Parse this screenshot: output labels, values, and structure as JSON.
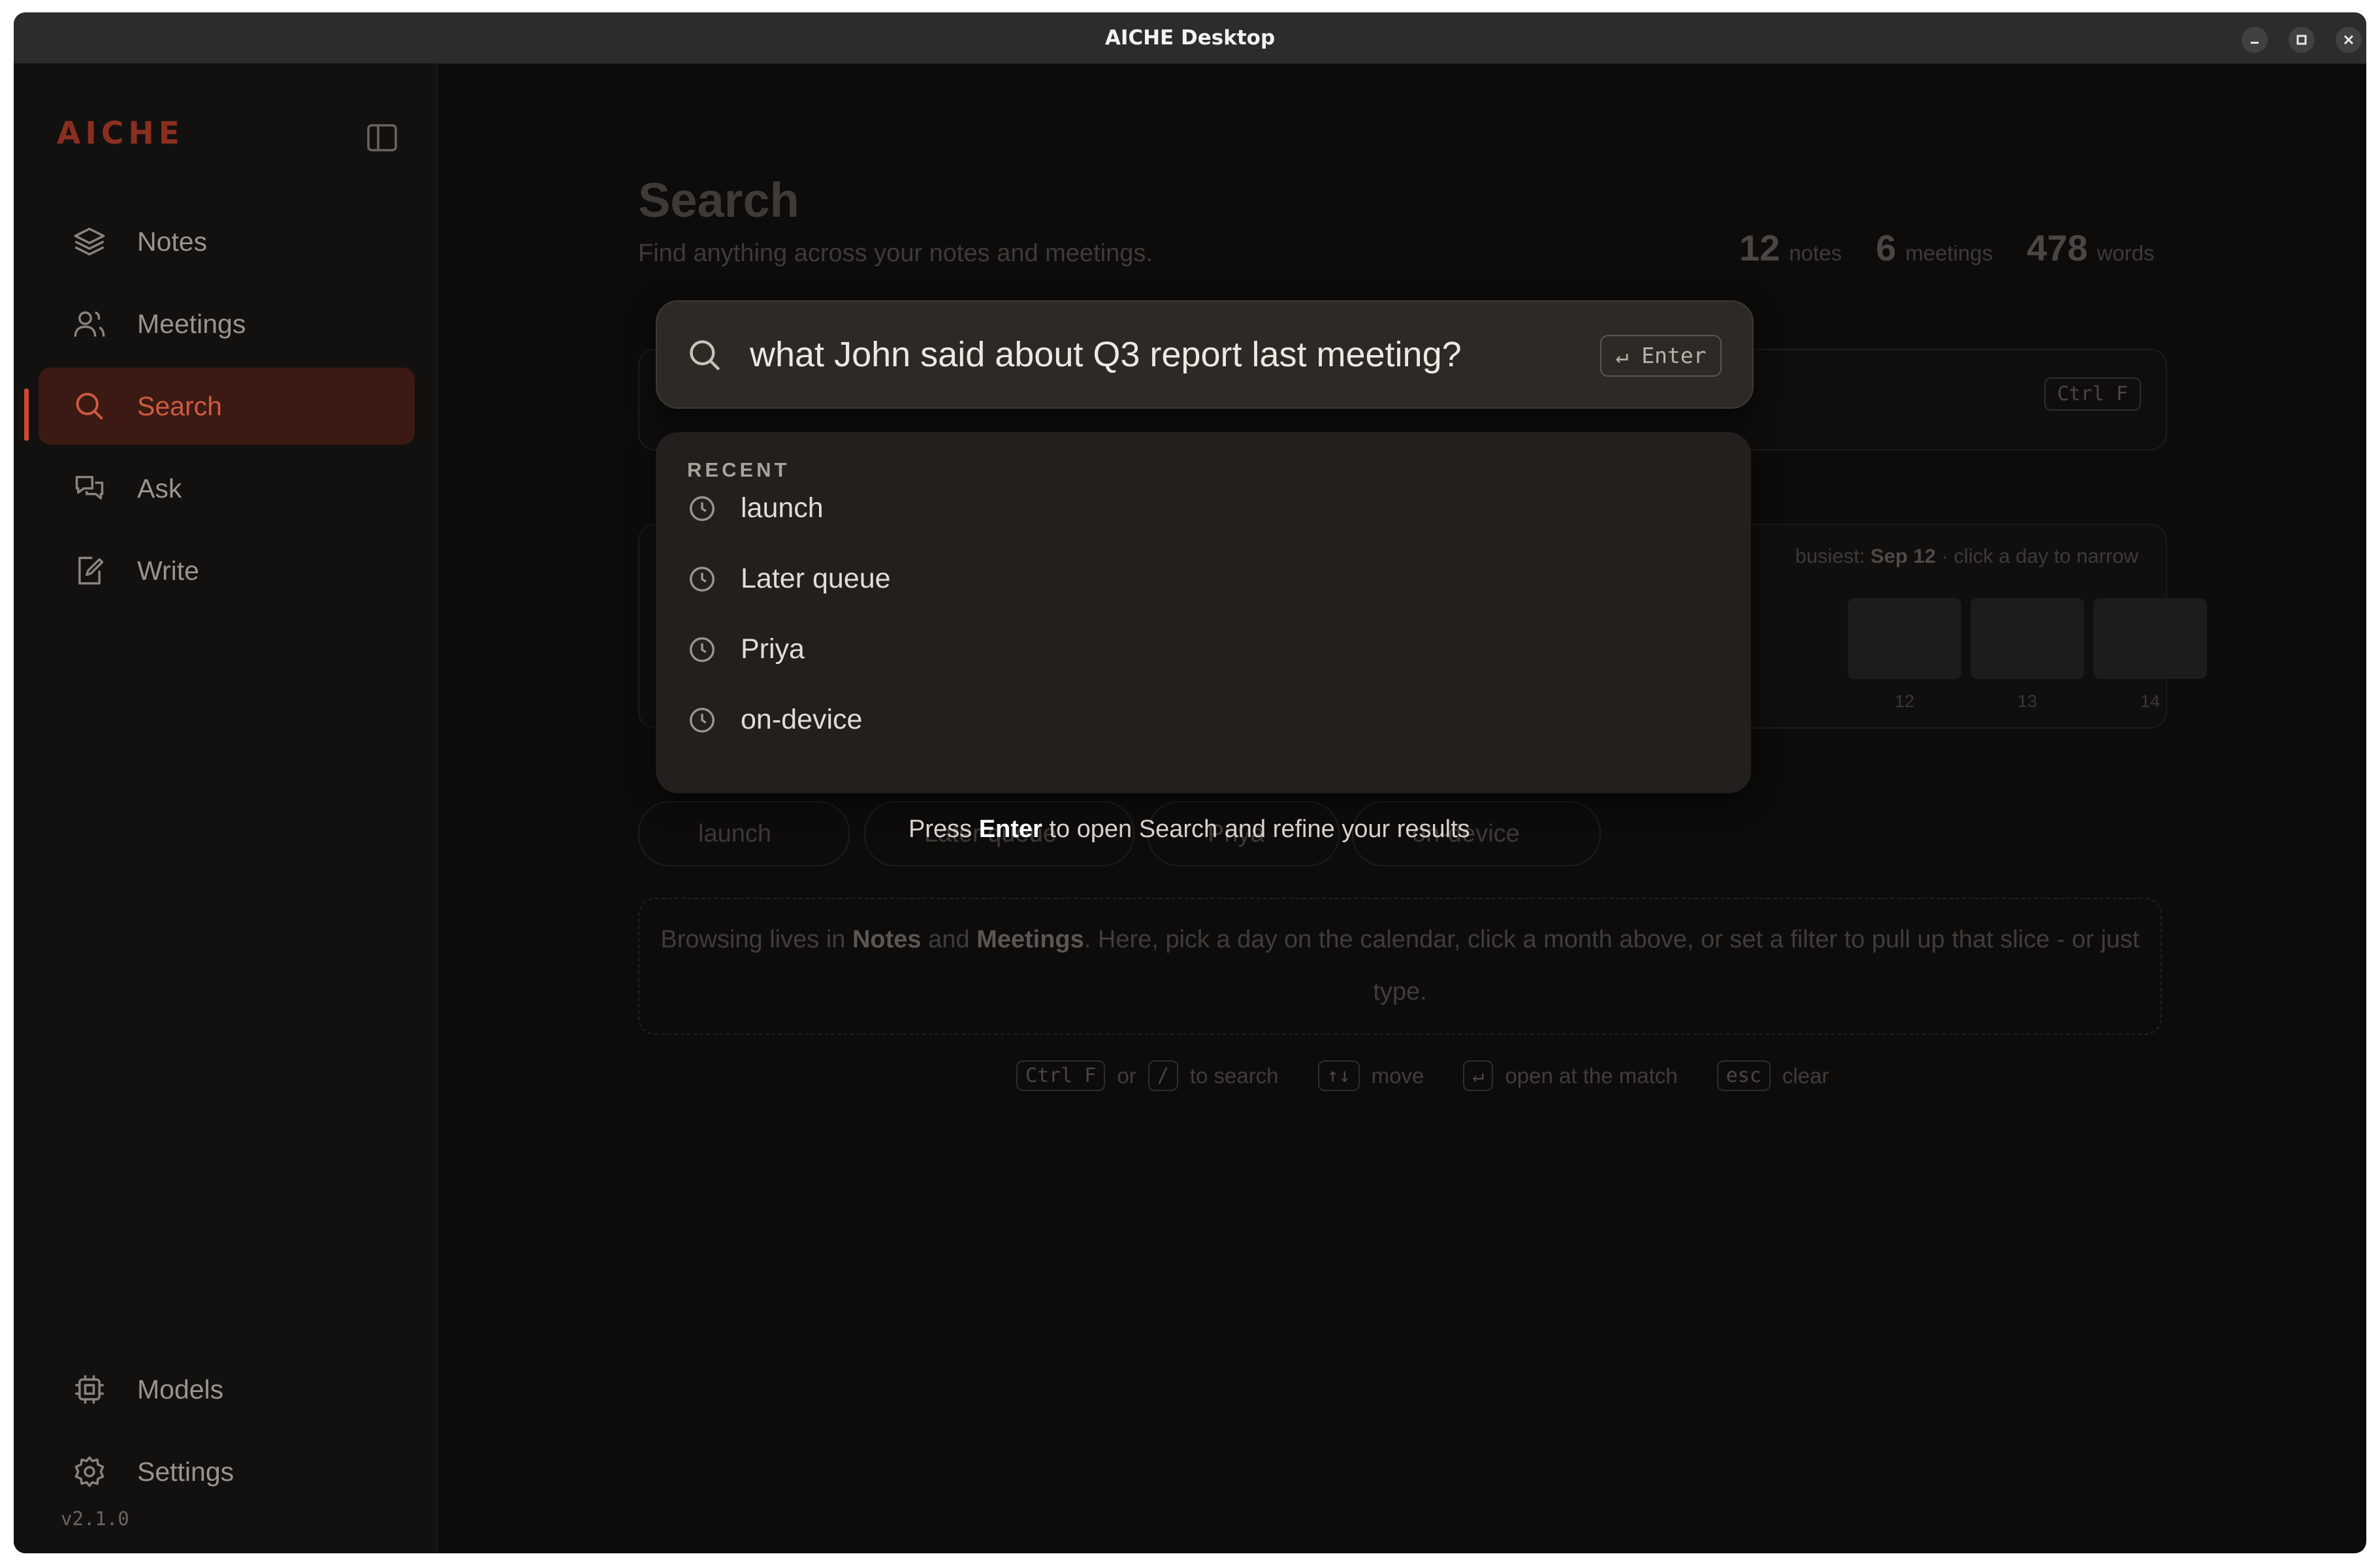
{
  "window": {
    "title": "AICHE Desktop"
  },
  "sidebar": {
    "logo": "AICHE",
    "items": [
      {
        "label": "Notes",
        "icon": "layers-icon"
      },
      {
        "label": "Meetings",
        "icon": "users-icon"
      },
      {
        "label": "Search",
        "icon": "search-icon",
        "active": true
      },
      {
        "label": "Ask",
        "icon": "chat-icon"
      },
      {
        "label": "Write",
        "icon": "edit-icon"
      }
    ],
    "bottom_items": [
      {
        "label": "Models",
        "icon": "chip-icon"
      },
      {
        "label": "Settings",
        "icon": "gear-icon"
      }
    ],
    "version": "v2.1.0"
  },
  "page": {
    "title": "Search",
    "subtitle": "Find anything across your notes and meetings.",
    "stats": [
      {
        "value": "12",
        "unit": "notes"
      },
      {
        "value": "6",
        "unit": "meetings"
      },
      {
        "value": "478",
        "unit": "words"
      }
    ],
    "shortcut_key": "Ctrl F",
    "calendar": {
      "busiest_prefix": "busiest:",
      "busiest_day": "Sep 12",
      "busiest_suffix": "· click a day to narrow",
      "days": [
        "12",
        "13",
        "14"
      ]
    },
    "chips": [
      "launch",
      "Later queue",
      "Priya",
      "on-device"
    ],
    "info": {
      "part1": "Browsing lives in ",
      "bold1": "Notes",
      "part2": " and ",
      "bold2": "Meetings",
      "part3": ". Here, pick a day on the calendar, click a month above, or set a filter to pull up that slice - or just type."
    },
    "hints": {
      "key1": "Ctrl F",
      "or": "or",
      "key2": "/",
      "to_search": "to search",
      "key3": "↑↓",
      "move": "move",
      "key4": "↵",
      "open": "open at the match",
      "key5": "esc",
      "clear": "clear"
    }
  },
  "command": {
    "query": "what John said about Q3 report last meeting?",
    "enter_label": "↵ Enter",
    "recent_heading": "RECENT",
    "recent": [
      "launch",
      "Later queue",
      "Priya",
      "on-device"
    ],
    "press_prefix": "Press ",
    "press_key": "Enter",
    "press_suffix": " to open Search and refine your results"
  },
  "colors": {
    "accent": "#cd5a40",
    "background": "#0d0c0b",
    "sidebar": "#121110",
    "overlay": "#2d2a26"
  }
}
